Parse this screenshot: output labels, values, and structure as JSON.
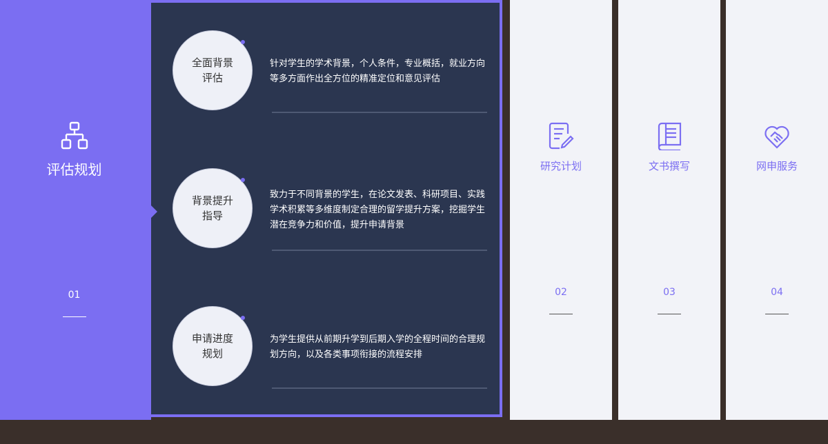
{
  "active_tab": {
    "title": "评估规划",
    "number": "01",
    "icon": "org-chart-icon"
  },
  "items": [
    {
      "title": "全面背景评估",
      "description": "针对学生的学术背景，个人条件，专业概括，就业方向等多方面作出全方位的精准定位和意见评估"
    },
    {
      "title": "背景提升指导",
      "description": "致力于不同背景的学生，在论文发表、科研项目、实践学术积累等多维度制定合理的留学提升方案，挖掘学生潜在竞争力和价值，提升申请背景"
    },
    {
      "title": "申请进度规划",
      "description": "为学生提供从前期升学到后期入学的全程时间的合理规划方向，以及各类事项衔接的流程安排"
    }
  ],
  "tabs": [
    {
      "title": "研究计划",
      "number": "02",
      "icon": "document-edit-icon"
    },
    {
      "title": "文书撰写",
      "number": "03",
      "icon": "book-icon"
    },
    {
      "title": "网申服务",
      "number": "04",
      "icon": "handshake-heart-icon"
    }
  ],
  "colors": {
    "accent": "#7b6ef2",
    "panel": "#2b3650",
    "tab_bg": "#f2f3f8"
  }
}
